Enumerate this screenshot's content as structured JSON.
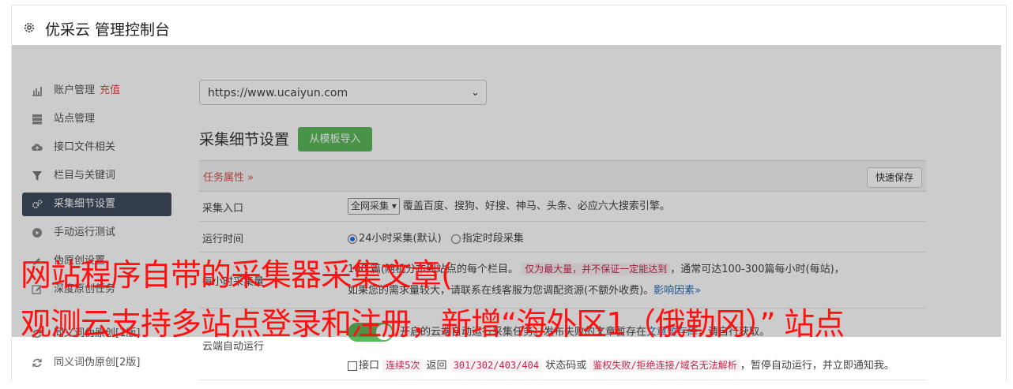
{
  "header": {
    "title": "优采云 管理控制台"
  },
  "sidebar": {
    "items": [
      {
        "label": "账户管理",
        "extra": "充值",
        "icon": "bar-chart-icon"
      },
      {
        "label": "站点管理",
        "icon": "server-icon"
      },
      {
        "label": "接口文件相关",
        "icon": "cloud-upload-icon"
      },
      {
        "label": "栏目与关键词",
        "icon": "filter-icon"
      },
      {
        "label": "采集细节设置",
        "icon": "cogs-icon",
        "active": true
      },
      {
        "label": "手动运行测试",
        "icon": "play-circle-icon"
      },
      {
        "label": "伪原创设置",
        "icon": "pencil-icon"
      },
      {
        "label": "深度原创任务",
        "icon": "edit-icon"
      },
      {
        "label": "同义词伪原创[1版]",
        "icon": "refresh-icon"
      },
      {
        "label": "同义词伪原创[2版]",
        "icon": "refresh-icon"
      }
    ]
  },
  "main": {
    "site_select": "https://www.ucaiyun.com",
    "section_title": "采集细节设置",
    "import_button": "从模板导入",
    "task_attr": "任务属性 »",
    "save_button": "快速保存",
    "rows": {
      "entry": {
        "label": "采集入口",
        "select": "全网采集",
        "desc": "覆盖百度、搜狗、好搜、神马、头条、必应六大搜索引擎。"
      },
      "time": {
        "label": "运行时间",
        "opt1": "24小时采集(默认)",
        "opt2": "指定时段采集"
      },
      "volume": {
        "label": "每小时采集量",
        "line1_a": "100",
        "line1_b": "篇(随机分布到站点的每个栏目。",
        "line1_tag": "仅为最大量，并不保证一定能达到",
        "line1_c": "，通常可达100-300篇每小时(每站)，",
        "line2_a": "如果您的需求量较大，请联系在线客服为您调配资源(不额外收费)。",
        "line2_link": "影响因素»"
      },
      "cloud": {
        "label": "云端自动运行",
        "line1_a": "开启的云端自动运行采集任务。发布失败的文章暂存在",
        "line1_link": "文章暂存库",
        "line1_b": "，请自行获取。",
        "line2_a": "接口",
        "line2_tag1": "连续5次",
        "line2_b": "返回",
        "line2_tag2": "301/302/403/404",
        "line2_c": "状态码或",
        "line2_tag3": "鉴权失败/拒绝连接/域名无法解析",
        "line2_d": "，暂停自动运行，并立即通知我。"
      }
    }
  },
  "overlay_caption": {
    "line1": "网站程序自带的采集器采集文章(",
    "line2": "观测云支持多站点登录和注册，新增“海外区1（俄勒冈）” 站点"
  }
}
